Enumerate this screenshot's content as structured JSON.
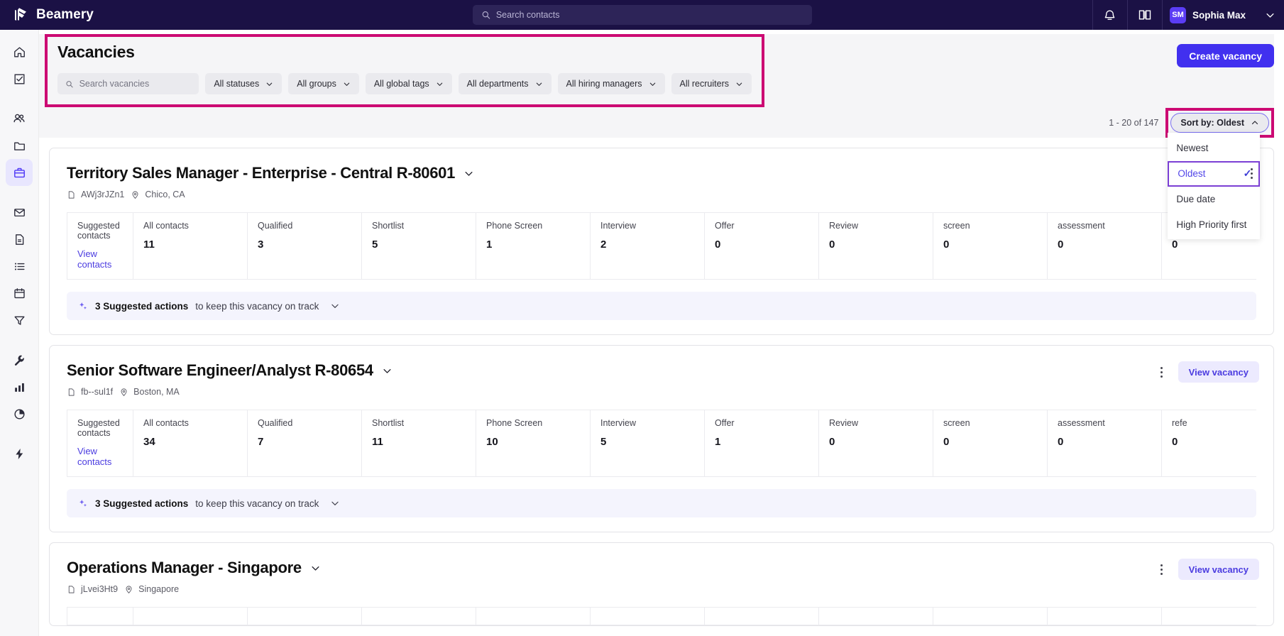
{
  "topbar": {
    "brand": "Beamery",
    "search_placeholder": "Search contacts",
    "search_value": "",
    "notifications_icon": "bell-icon",
    "docs_icon": "book-icon",
    "avatar_initials": "SM",
    "user_name": "Sophia Max"
  },
  "sidebar": {
    "items": [
      {
        "icon": "home-icon",
        "name": "home",
        "active": false
      },
      {
        "icon": "tasks-icon",
        "name": "tasks",
        "active": false
      },
      {
        "icon": "people-icon",
        "name": "contacts",
        "active": false
      },
      {
        "icon": "folder-icon",
        "name": "projects",
        "active": false
      },
      {
        "icon": "briefcase-icon",
        "name": "vacancies",
        "active": true
      },
      {
        "icon": "mail-icon",
        "name": "messages",
        "active": false
      },
      {
        "icon": "document-icon",
        "name": "documents",
        "active": false
      },
      {
        "icon": "list-icon",
        "name": "lists",
        "active": false
      },
      {
        "icon": "calendar-icon",
        "name": "calendar",
        "active": false
      },
      {
        "icon": "filter-icon",
        "name": "filters",
        "active": false
      },
      {
        "icon": "wrench-icon",
        "name": "tools",
        "active": false
      },
      {
        "icon": "bar-chart-icon",
        "name": "analytics",
        "active": false
      },
      {
        "icon": "pie-chart-icon",
        "name": "reports",
        "active": false
      },
      {
        "icon": "lightning-icon",
        "name": "automation",
        "active": false
      }
    ]
  },
  "header": {
    "title": "Vacancies",
    "create_button": "Create vacancy",
    "search_placeholder": "Search vacancies",
    "search_value": "",
    "filters": [
      {
        "label": "All statuses"
      },
      {
        "label": "All groups"
      },
      {
        "label": "All global tags"
      },
      {
        "label": "All departments"
      },
      {
        "label": "All hiring managers"
      },
      {
        "label": "All recruiters"
      }
    ],
    "highlight_color": "#cc0a73"
  },
  "subbar": {
    "result_count": "1 - 20 of 147",
    "sort_button_label": "Sort by: Oldest",
    "sort_options": [
      {
        "label": "Newest",
        "selected": false
      },
      {
        "label": "Oldest",
        "selected": true
      },
      {
        "label": "Due date",
        "selected": false
      },
      {
        "label": "High Priority first",
        "selected": false
      }
    ],
    "check_glyph": "✓"
  },
  "stat_columns": [
    "Suggested contacts",
    "All contacts",
    "Qualified",
    "Shortlist",
    "Phone Screen",
    "Interview",
    "Offer",
    "Review",
    "screen",
    "assessment",
    "refe"
  ],
  "view_contacts_label": "View contacts",
  "view_vacancy_label": "View vacancy",
  "suggest_text": {
    "count": "3 Suggested actions",
    "rest": "to keep this vacancy on track"
  },
  "vacancies": [
    {
      "title": "Territory Sales Manager - Enterprise - Central R-80601",
      "ref": "AWj3rJZn1",
      "location": "Chico, CA",
      "stats": [
        "11",
        "3",
        "5",
        "1",
        "2",
        "0",
        "0",
        "0",
        "0",
        "0"
      ],
      "has_view_button": false
    },
    {
      "title": "Senior Software Engineer/Analyst R-80654",
      "ref": "fb--sul1f",
      "location": "Boston, MA",
      "stats": [
        "34",
        "7",
        "11",
        "10",
        "5",
        "1",
        "0",
        "0",
        "0",
        "0"
      ],
      "has_view_button": true
    },
    {
      "title": "Operations Manager - Singapore",
      "ref": "jLvei3Ht9",
      "location": "Singapore",
      "stats": [
        "",
        "",
        "",
        "",
        "",
        "",
        "",
        "",
        "",
        ""
      ],
      "has_view_button": true
    }
  ]
}
